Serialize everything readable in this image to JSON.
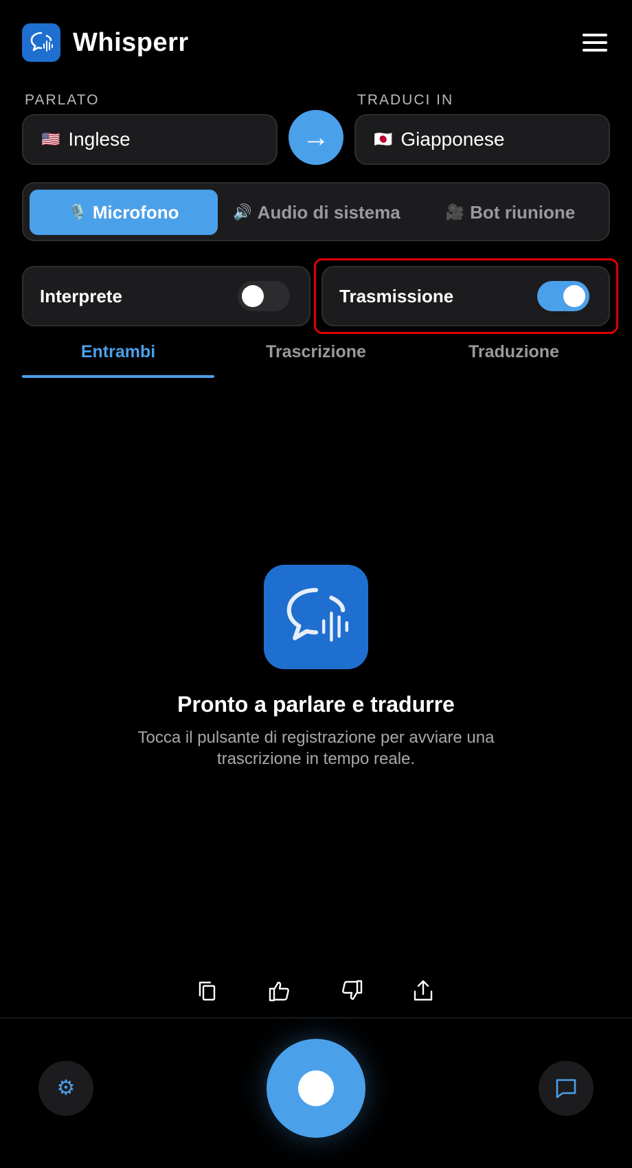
{
  "app": {
    "title": "Whisperr"
  },
  "languages": {
    "source_label": "PARLATO",
    "source_flag": "🇺🇸",
    "source_value": "Inglese",
    "target_label": "TRADUCI IN",
    "target_flag": "🇯🇵",
    "target_value": "Giapponese",
    "swap_glyph": "→"
  },
  "input_source": {
    "items": [
      {
        "icon": "🎙️",
        "label": "Microfono",
        "active": true
      },
      {
        "icon": "🔊",
        "label": "Audio di sistema",
        "active": false
      },
      {
        "icon": "🎥",
        "label": "Bot riunione",
        "active": false
      }
    ]
  },
  "toggles": {
    "interpreter": {
      "label": "Interprete",
      "on": false
    },
    "broadcast": {
      "label": "Trasmissione",
      "on": true
    }
  },
  "view_tabs": {
    "items": [
      "Entrambi",
      "Trascrizione",
      "Traduzione"
    ],
    "active_index": 0
  },
  "empty_state": {
    "title": "Pronto a parlare e tradurre",
    "description": "Tocca il pulsante di registrazione per avviare una trascrizione in tempo reale."
  },
  "bottom_bar": {
    "settings_glyph": "⚙"
  },
  "colors": {
    "accent": "#4ba0ea",
    "logo": "#1f6fd1",
    "surface": "#1c1c1e",
    "highlight": "#e00000"
  }
}
